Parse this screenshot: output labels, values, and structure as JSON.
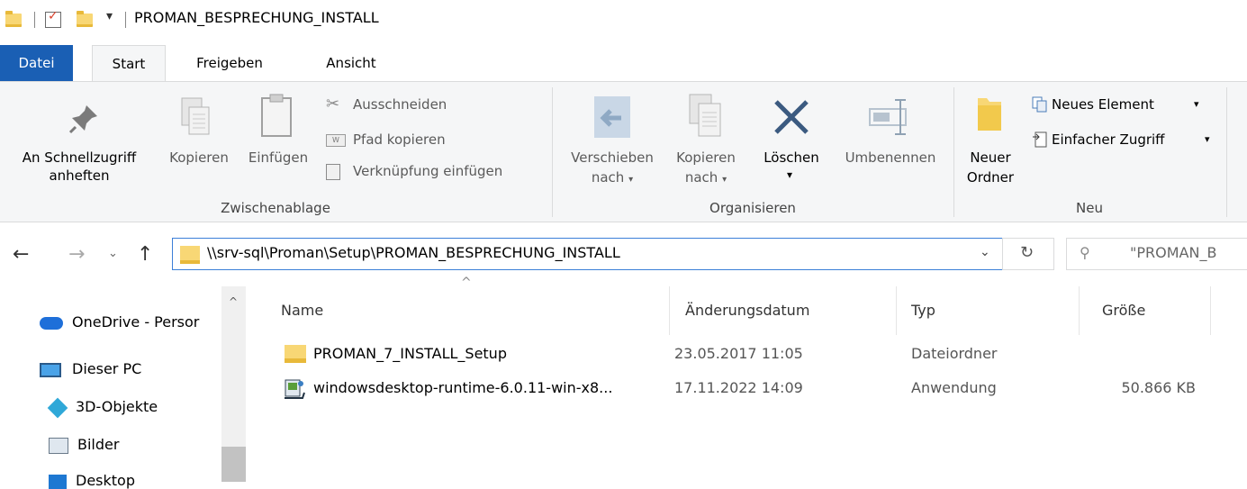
{
  "window": {
    "title": "PROMAN_BESPRECHUNG_INSTALL",
    "qat_dropdown_glyph": "▾"
  },
  "tabs": [
    {
      "label": "Datei"
    },
    {
      "label": "Start"
    },
    {
      "label": "Freigeben"
    },
    {
      "label": "Ansicht"
    }
  ],
  "ribbon": {
    "clipboard": {
      "group_label": "Zwischenablage",
      "pin_line1": "An Schnellzugriff",
      "pin_line2": "anheften",
      "copy": "Kopieren",
      "paste": "Einfügen",
      "cut": "Ausschneiden",
      "copy_path": "Pfad kopieren",
      "paste_shortcut": "Verknüpfung einfügen"
    },
    "organize": {
      "group_label": "Organisieren",
      "move_line1": "Verschieben",
      "move_line2": "nach",
      "copyto_line1": "Kopieren",
      "copyto_line2": "nach",
      "delete": "Löschen",
      "rename": "Umbenennen"
    },
    "new": {
      "group_label": "Neu",
      "new_folder_line1": "Neuer",
      "new_folder_line2": "Ordner",
      "new_item": "Neues Element",
      "easy_access": "Einfacher Zugriff"
    }
  },
  "address": {
    "path": "\\\\srv-sql\\Proman\\Setup\\PROMAN_BESPRECHUNG_INSTALL",
    "search_placeholder": "\"PROMAN_B"
  },
  "navpane": {
    "items": [
      {
        "label": "OneDrive - Persor"
      },
      {
        "label": "Dieser PC"
      },
      {
        "label": "3D-Objekte"
      },
      {
        "label": "Bilder"
      },
      {
        "label": "Desktop"
      }
    ]
  },
  "filelist": {
    "columns": [
      "Name",
      "Änderungsdatum",
      "Typ",
      "Größe"
    ],
    "rows": [
      {
        "name": "PROMAN_7_INSTALL_Setup",
        "date": "23.05.2017 11:05",
        "type": "Dateiordner",
        "size": "",
        "icon": "folder-icon"
      },
      {
        "name": "windowsdesktop-runtime-6.0.11-win-x8...",
        "date": "17.11.2022 14:09",
        "type": "Anwendung",
        "size": "50.866 KB",
        "icon": "installer-icon"
      }
    ]
  },
  "colors": {
    "accent": "#1a5fb4",
    "folder": "#f8d775",
    "ribbon_bg": "#f5f6f7",
    "address_border": "#3c7fd8"
  }
}
